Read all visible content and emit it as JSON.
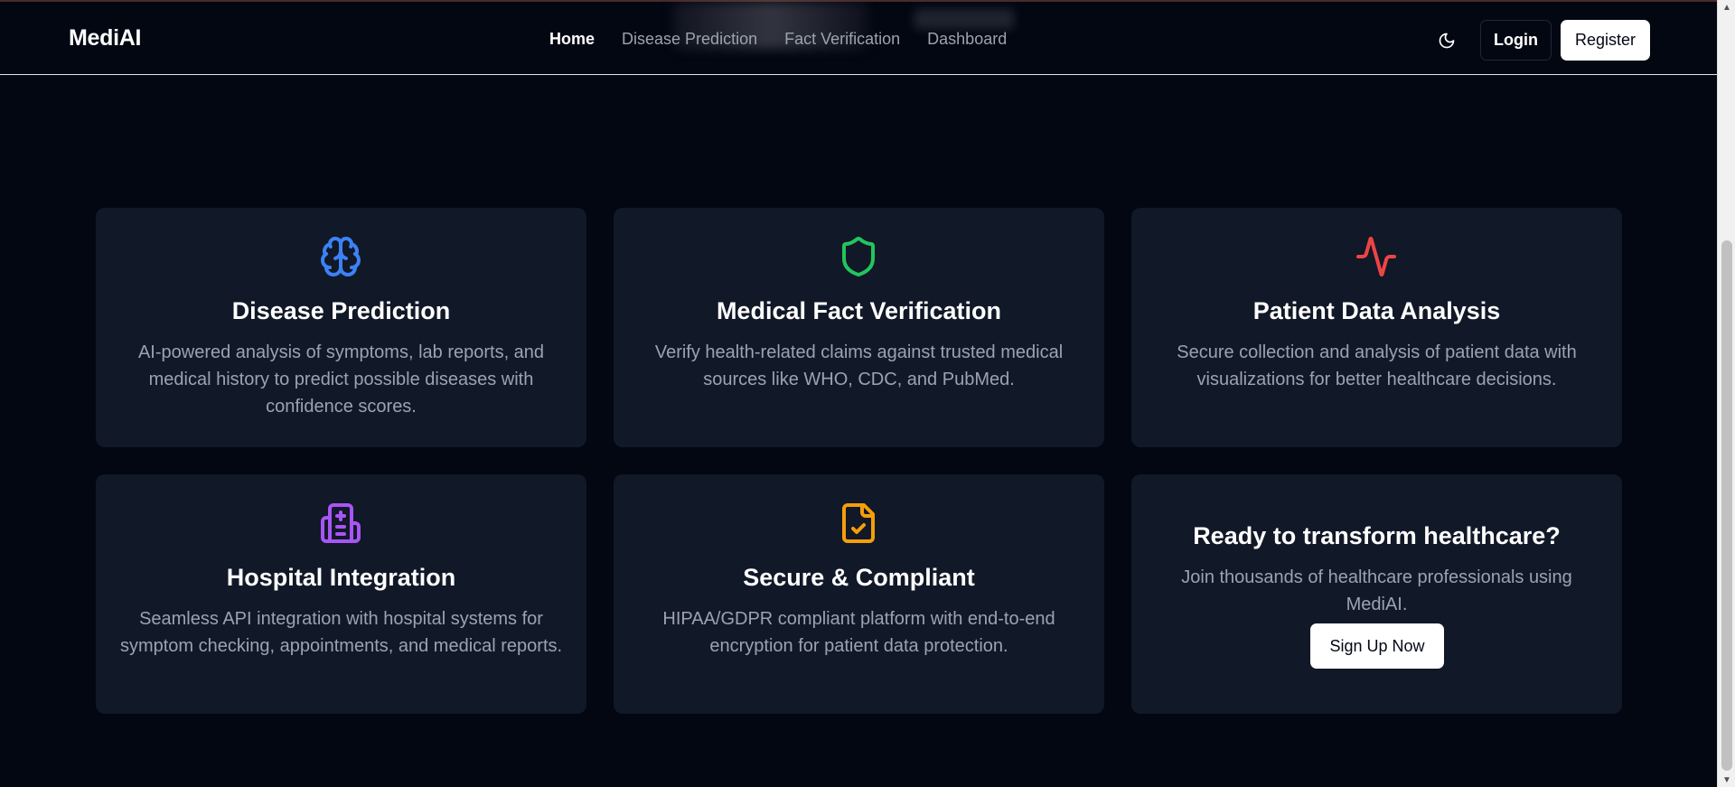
{
  "header": {
    "brand": "MediAI",
    "nav": [
      {
        "label": "Home",
        "active": true
      },
      {
        "label": "Disease Prediction",
        "active": false
      },
      {
        "label": "Fact Verification",
        "active": false
      },
      {
        "label": "Dashboard",
        "active": false
      }
    ],
    "theme_toggle_icon": "moon-icon",
    "login_label": "Login",
    "register_label": "Register"
  },
  "features": [
    {
      "icon": "brain-icon",
      "icon_color": "#3b82f6",
      "title": "Disease Prediction",
      "description": "AI-powered analysis of symptoms, lab reports, and medical history to predict possible diseases with confidence scores."
    },
    {
      "icon": "shield-icon",
      "icon_color": "#22c55e",
      "title": "Medical Fact Verification",
      "description": "Verify health-related claims against trusted medical sources like WHO, CDC, and PubMed."
    },
    {
      "icon": "activity-icon",
      "icon_color": "#ef4444",
      "title": "Patient Data Analysis",
      "description": "Secure collection and analysis of patient data with visualizations for better healthcare decisions."
    },
    {
      "icon": "hospital-icon",
      "icon_color": "#a855f7",
      "title": "Hospital Integration",
      "description": "Seamless API integration with hospital systems for symptom checking, appointments, and medical reports."
    },
    {
      "icon": "file-check-icon",
      "icon_color": "#f59e0b",
      "title": "Secure & Compliant",
      "description": "HIPAA/GDPR compliant platform with end-to-end encryption for patient data protection."
    }
  ],
  "cta": {
    "title": "Ready to transform healthcare?",
    "description": "Join thousands of healthcare professionals using MediAI.",
    "button_label": "Sign Up Now"
  },
  "colors": {
    "background": "#030712",
    "card": "#111827",
    "muted_text": "#9ca3af"
  }
}
